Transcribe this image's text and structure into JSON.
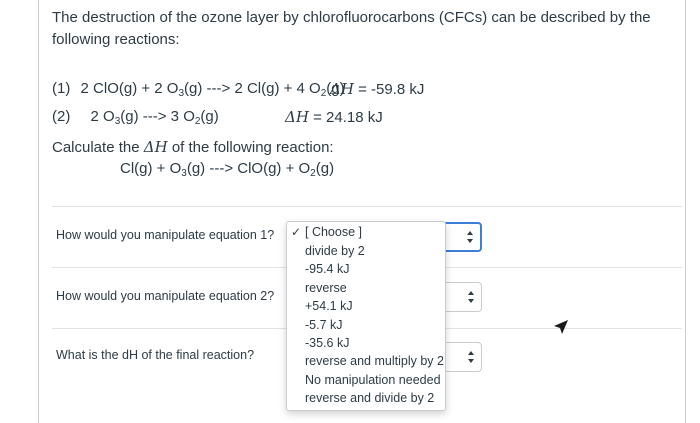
{
  "intro": "The destruction of the ozone layer by chlorofluorocarbons (CFCs) can be described by the following reactions:",
  "eq1": {
    "label": "(1)",
    "parts": [
      "2 ClO(g) + 2 O",
      "3",
      "(g) ---> 2 Cl(g) + 4 O",
      "2",
      "(g)"
    ],
    "dh_symbol": "ΔH",
    "dh_value": " = -59.8 kJ"
  },
  "eq2": {
    "label": "(2)",
    "parts": [
      "2 O",
      "3",
      "(g) ---> 3 O",
      "2",
      "(g)"
    ],
    "dh_symbol": "ΔH",
    "dh_value": " = 24.18 kJ"
  },
  "calculate": {
    "prefix": "Calculate the ",
    "symbol": "ΔH",
    "suffix": " of the following reaction:"
  },
  "target_reaction": {
    "parts": [
      "Cl(g) + O",
      "3",
      "(g) ---> ClO(g) + O",
      "2",
      "(g)"
    ]
  },
  "questions": [
    {
      "text": "How would you manipulate equation 1?"
    },
    {
      "text": "How would you manipulate equation 2?"
    },
    {
      "text": "What is the dH of the final reaction?"
    }
  ],
  "dropdown": {
    "selected": "[ Choose ]",
    "check_icon": "checkmark-icon",
    "options": [
      "divide by 2",
      "-95.4 kJ",
      "reverse",
      "+54.1 kJ",
      "-5.7 kJ",
      "-35.6 kJ",
      "reverse and multiply by 2",
      "No manipulation needed",
      "reverse and divide by 2"
    ]
  },
  "colors": {
    "text": "#2d3b45",
    "focus_border": "#3b7fd6",
    "border": "#c7cdd1"
  }
}
